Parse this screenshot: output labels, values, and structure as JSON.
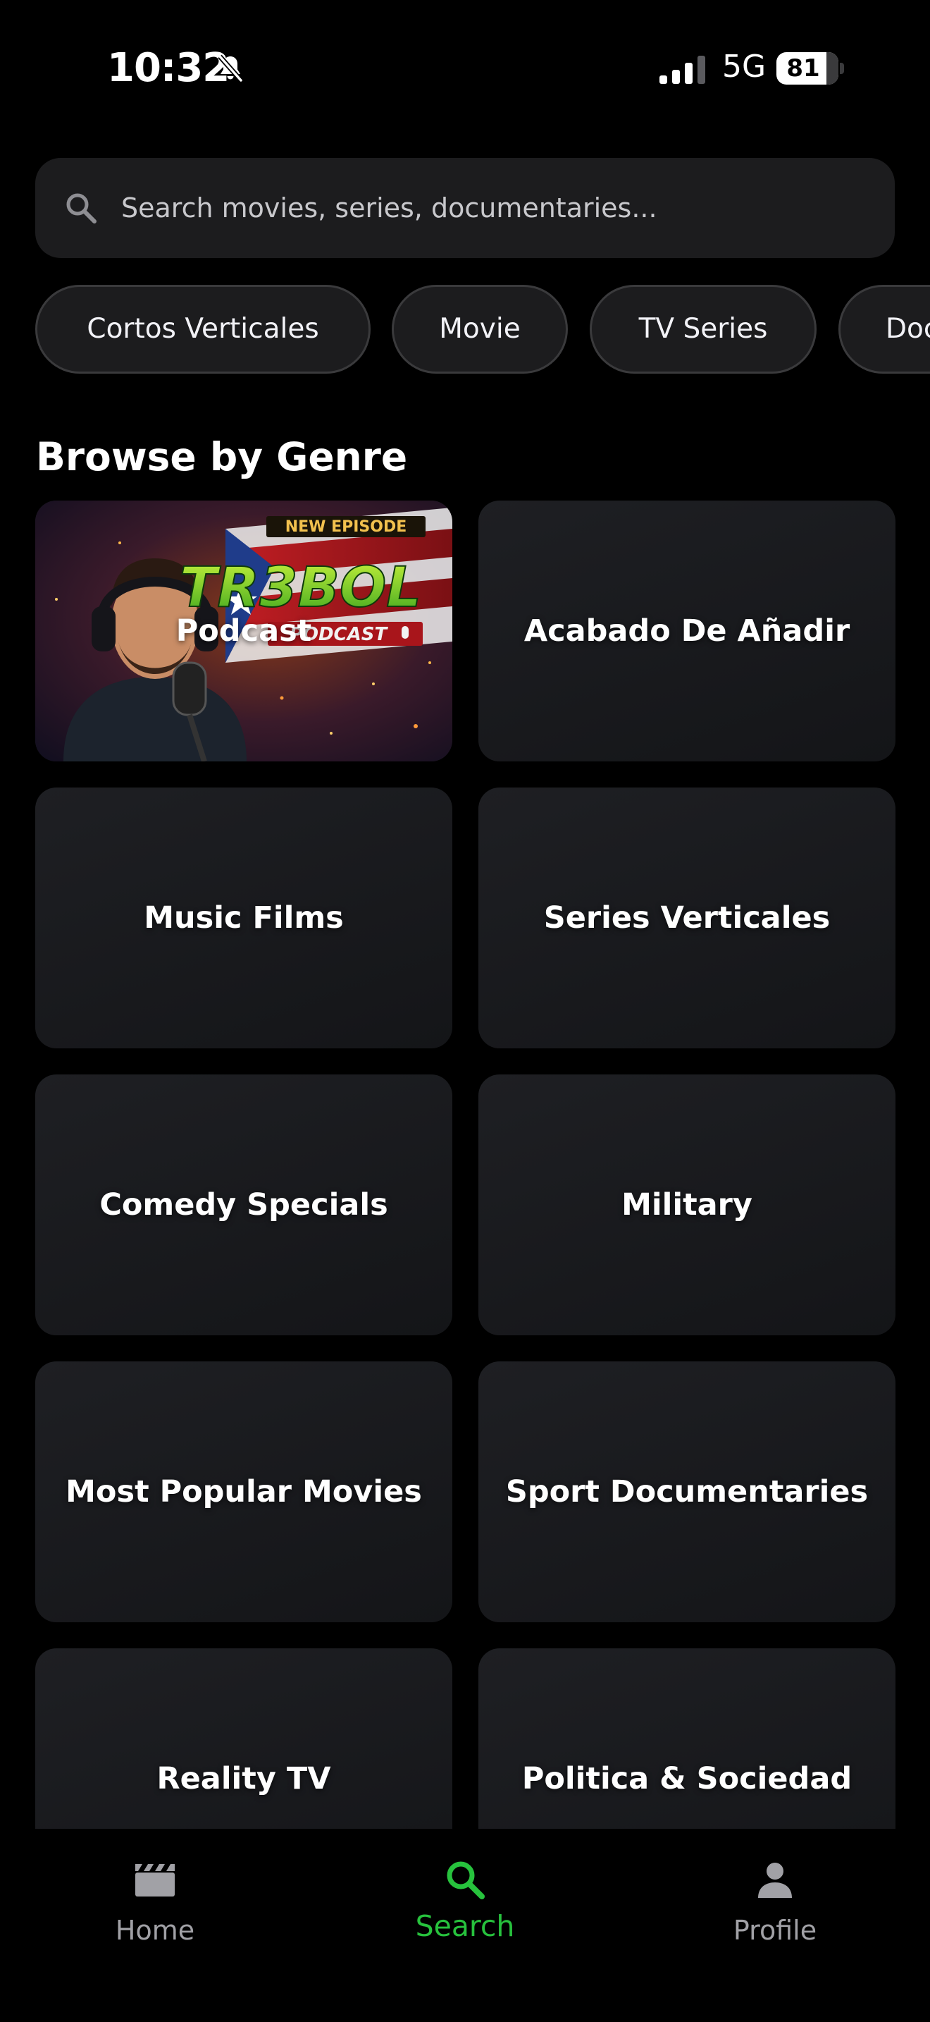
{
  "status_bar": {
    "time": "10:32",
    "network": "5G",
    "battery_level": "81",
    "icons": [
      "bell-slash-icon",
      "cellular-signal-icon",
      "battery-charging-icon"
    ]
  },
  "search": {
    "placeholder": "Search movies, series, documentaries...",
    "value": "",
    "icon": "search-icon"
  },
  "filter_chips": [
    {
      "label": "Cortos Verticales"
    },
    {
      "label": "Movie"
    },
    {
      "label": "TV Series"
    },
    {
      "label": "Documentaries"
    }
  ],
  "browse": {
    "title": "Browse by Genre",
    "genres": [
      {
        "label": "Podcast",
        "has_image": true,
        "image_text": {
          "badge": "NEW EPISODE",
          "title": "TR3BOL",
          "subtitle": "PODCAST"
        }
      },
      {
        "label": "Acabado De Añadir"
      },
      {
        "label": "Music Films"
      },
      {
        "label": "Series Verticales"
      },
      {
        "label": "Comedy Specials"
      },
      {
        "label": "Military"
      },
      {
        "label": "Most Popular Movies"
      },
      {
        "label": "Sport Documentaries"
      },
      {
        "label": "Reality TV"
      },
      {
        "label": "Politica & Sociedad"
      }
    ]
  },
  "tab_bar": {
    "tabs": [
      {
        "label": "Home",
        "icon": "clapperboard-icon",
        "active": false
      },
      {
        "label": "Search",
        "icon": "search-icon",
        "active": true
      },
      {
        "label": "Profile",
        "icon": "person-icon",
        "active": false
      }
    ]
  },
  "colors": {
    "background": "#000000",
    "surface": "#1c1c1e",
    "accent": "#27c23d",
    "inactive": "#a1a1a6"
  }
}
